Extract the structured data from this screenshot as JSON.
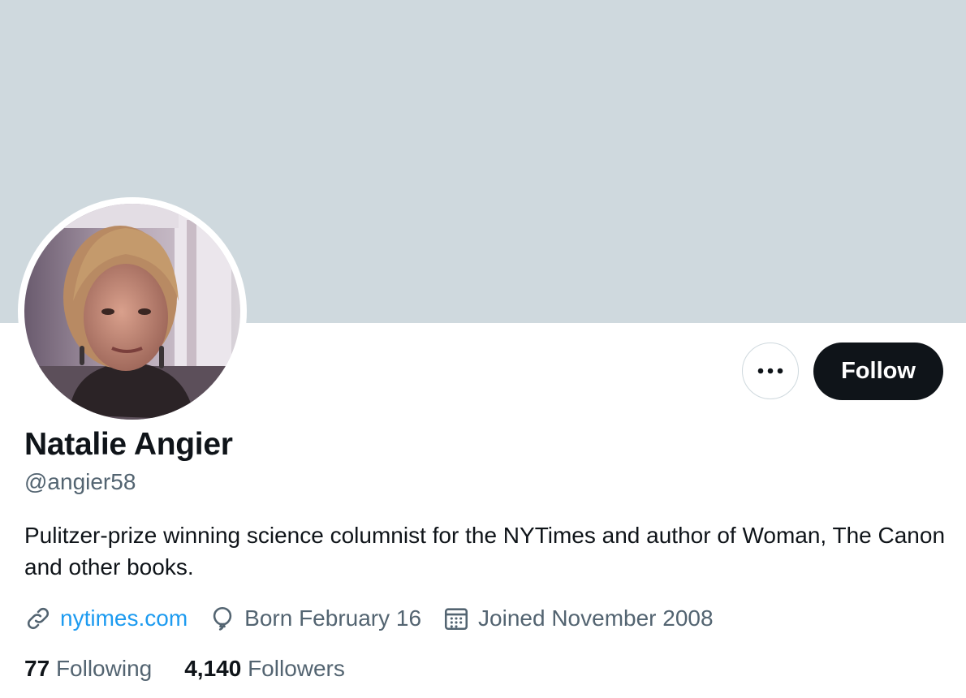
{
  "profile": {
    "display_name": "Natalie Angier",
    "handle": "@angier58",
    "bio": "Pulitzer-prize winning science columnist for the NYTimes and author of Woman, The Canon and other books.",
    "website": "nytimes.com",
    "birthday": "Born February 16",
    "joined": "Joined November 2008"
  },
  "actions": {
    "more_icon": "more-horizontal-icon",
    "follow_label": "Follow"
  },
  "stats": {
    "following_count": "77",
    "following_label": "Following",
    "followers_count": "4,140",
    "followers_label": "Followers"
  },
  "icons": {
    "website": "link-icon",
    "birthday": "balloon-icon",
    "joined": "calendar-icon"
  },
  "colors": {
    "banner": "#cfd9de",
    "primary_text": "#0f1419",
    "secondary_text": "#536471",
    "link": "#1d9bf0",
    "follow_button": "#0f1419"
  }
}
